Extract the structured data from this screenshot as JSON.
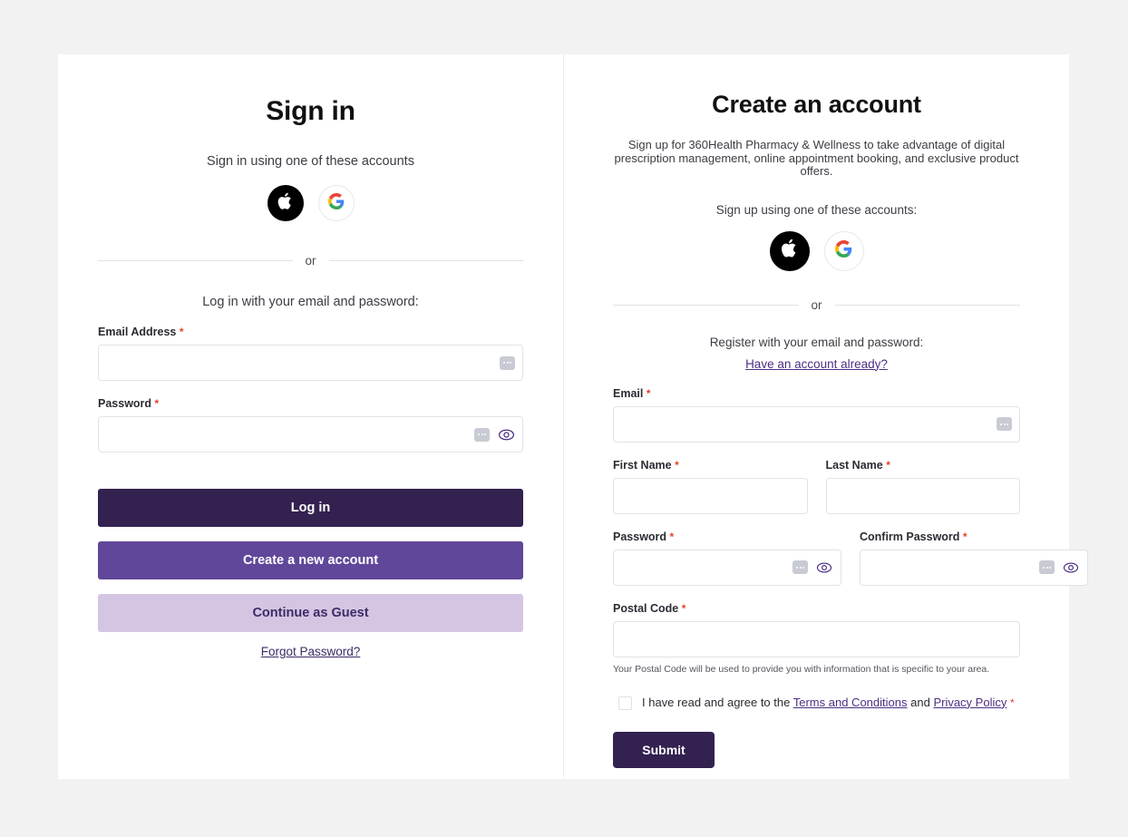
{
  "colors": {
    "page_background": "#f2f2f2",
    "card_background": "#ffffff",
    "primary_dark": "#332150",
    "primary_mid": "#60479a",
    "primary_light": "#d4c6e3",
    "link": "#4c2f83",
    "required_asterisk": "#e8402a",
    "apple_button": "#000000",
    "google_g_blue": "#4285f4",
    "google_g_red": "#ea4335",
    "google_g_yellow": "#fbbc05",
    "google_g_green": "#34a853"
  },
  "signin": {
    "title": "Sign in",
    "accounts_prompt": "Sign in using one of these accounts",
    "social": [
      {
        "name": "apple",
        "icon": "apple-icon"
      },
      {
        "name": "google",
        "icon": "google-icon"
      }
    ],
    "or_label": "or",
    "email_password_prompt": "Log in with your email and password:",
    "fields": [
      {
        "label": "Email Address",
        "required": "*",
        "value": "",
        "placeholder": ""
      },
      {
        "label": "Password",
        "required": "*",
        "value": "",
        "placeholder": ""
      }
    ],
    "buttons": {
      "login": "Log in",
      "create_account": "Create a new account",
      "guest": "Continue as Guest"
    },
    "forgot_password": "Forgot Password?"
  },
  "signup": {
    "title": "Create an account",
    "description": "Sign up for 360Health Pharmacy & Wellness to take advantage of digital prescription management, online appointment booking, and exclusive product offers.",
    "accounts_prompt": "Sign up using one of these accounts:",
    "social": [
      {
        "name": "apple",
        "icon": "apple-icon"
      },
      {
        "name": "google",
        "icon": "google-icon"
      }
    ],
    "or_label": "or",
    "register_prompt": "Register with your email and password:",
    "have_account_link": "Have an account already?",
    "fields": {
      "email": {
        "label": "Email",
        "required": "*",
        "value": "",
        "placeholder": ""
      },
      "first_name": {
        "label": "First Name",
        "required": "*",
        "value": "",
        "placeholder": ""
      },
      "last_name": {
        "label": "Last Name",
        "required": "*",
        "value": "",
        "placeholder": ""
      },
      "password": {
        "label": "Password",
        "required": "*",
        "value": "",
        "placeholder": ""
      },
      "confirm_password": {
        "label": "Confirm Password",
        "required": "*",
        "value": "",
        "placeholder": ""
      },
      "postal_code": {
        "label": "Postal Code",
        "required": "*",
        "value": "",
        "placeholder": ""
      }
    },
    "postal_code_hint": "Your Postal Code will be used to provide you with information that is specific to your area.",
    "terms": {
      "checked": false,
      "prefix": "I have read and agree to the",
      "terms_link": "Terms and Conditions",
      "conjunction": "and",
      "privacy_link": "Privacy Policy",
      "required": "*"
    },
    "submit_label": "Submit"
  }
}
